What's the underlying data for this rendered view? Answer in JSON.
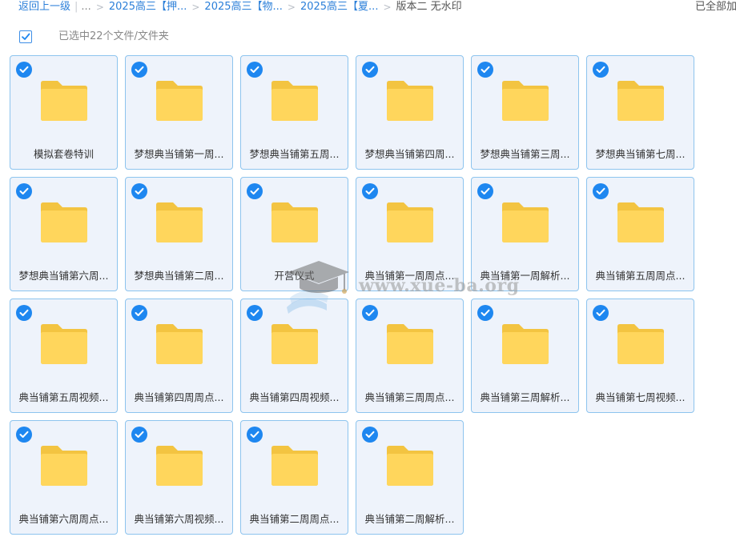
{
  "breadcrumb": {
    "back": "返回上一级",
    "ellipsis": "...",
    "items": [
      "2025高三【押...",
      "2025高三【物...",
      "2025高三【夏..."
    ],
    "current": "版本二 无水印",
    "right_status": "已全部加载"
  },
  "selection": {
    "summary": "已选中22个文件/文件夹"
  },
  "folders": [
    {
      "name": "模拟套卷特训"
    },
    {
      "name": "梦想典当铺第一周..."
    },
    {
      "name": "梦想典当铺第五周..."
    },
    {
      "name": "梦想典当铺第四周..."
    },
    {
      "name": "梦想典当铺第三周..."
    },
    {
      "name": "梦想典当铺第七周..."
    },
    {
      "name": "梦想典当铺第六周..."
    },
    {
      "name": "梦想典当铺第二周..."
    },
    {
      "name": "开营仪式"
    },
    {
      "name": "典当铺第一周周点..."
    },
    {
      "name": "典当铺第一周解析..."
    },
    {
      "name": "典当铺第五周周点..."
    },
    {
      "name": "典当铺第五周视频..."
    },
    {
      "name": "典当铺第四周周点..."
    },
    {
      "name": "典当铺第四周视频..."
    },
    {
      "name": "典当铺第三周周点..."
    },
    {
      "name": "典当铺第三周解析..."
    },
    {
      "name": "典当铺第七周视频..."
    },
    {
      "name": "典当铺第六周周点..."
    },
    {
      "name": "典当铺第六周视频..."
    },
    {
      "name": "典当铺第二周周点..."
    },
    {
      "name": "典当铺第二周解析..."
    }
  ],
  "watermark": {
    "text": "www.xue-ba.org",
    "icon": "graduation-cap-icon"
  },
  "colors": {
    "accent": "#1e87f0",
    "link": "#2b7fd9",
    "tile_bg": "#eef3fb",
    "tile_border": "#8dc4ee",
    "folder_back": "#f3c441",
    "folder_front": "#ffd65c"
  }
}
